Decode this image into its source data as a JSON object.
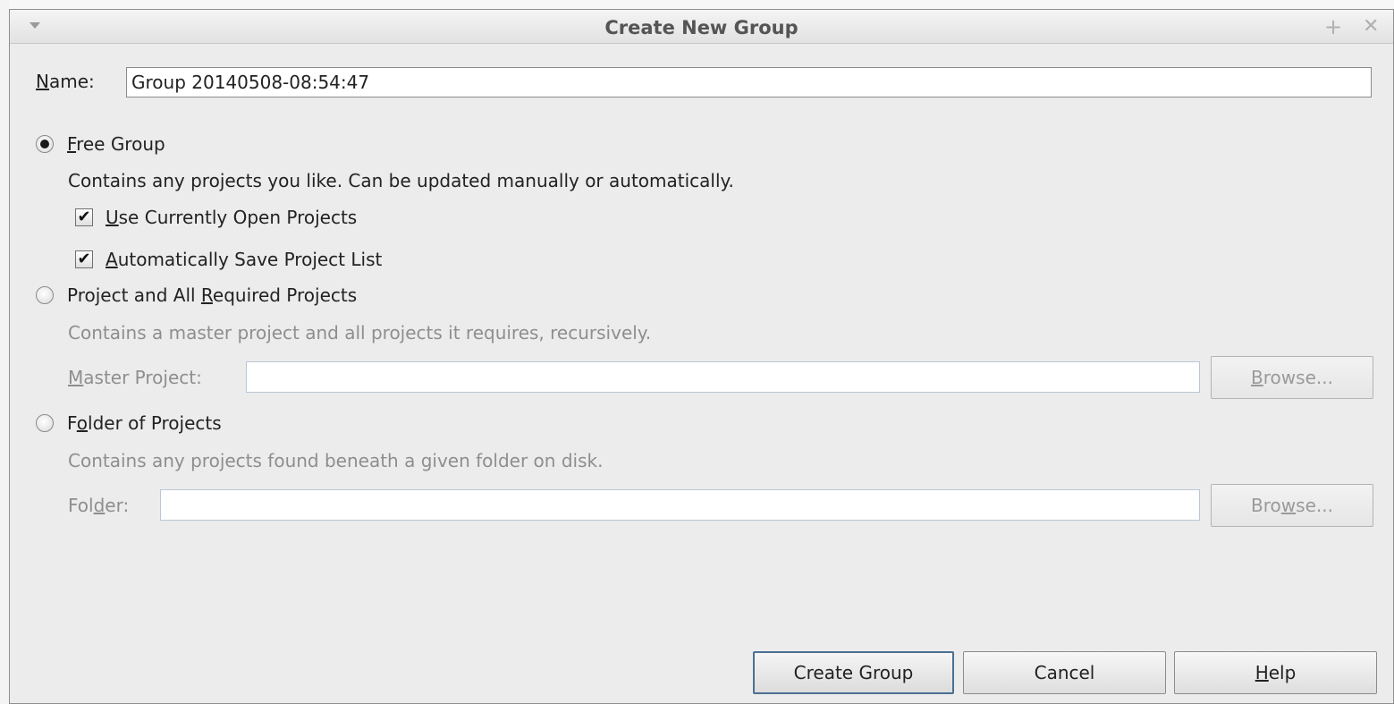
{
  "dialog": {
    "title": "Create New Group"
  },
  "name_field": {
    "label_mnemonic": "N",
    "label_rest": "ame:",
    "value": "Group 20140508-08:54:47"
  },
  "free_group": {
    "radio_mnemonic": "F",
    "radio_rest": "ree Group",
    "selected": true,
    "description": "Contains any projects you like. Can be updated manually or automatically.",
    "use_open_mnemonic": "U",
    "use_open_rest": "se Currently Open Projects",
    "use_open_checked": true,
    "auto_save_mnemonic": "A",
    "auto_save_rest": "utomatically Save Project List",
    "auto_save_checked": true
  },
  "project_group": {
    "radio_pre": "Project and All ",
    "radio_mnemonic": "R",
    "radio_rest": "equired Projects",
    "description": "Contains a master project and all projects it requires, recursively.",
    "master_mnemonic": "M",
    "master_rest": "aster Project:",
    "browse_mnemonic": "B",
    "browse_rest": "rowse..."
  },
  "folder_group": {
    "radio_pre": "F",
    "radio_mnemonic": "o",
    "radio_rest": "lder of Projects",
    "description": "Contains any projects found beneath a given folder on disk.",
    "folder_pre": "Fol",
    "folder_mnemonic": "d",
    "folder_rest": "er:",
    "browse_pre": "Bro",
    "browse_mnemonic": "w",
    "browse_rest": "se..."
  },
  "buttons": {
    "create": "Create Group",
    "cancel": "Cancel",
    "help_mnemonic": "H",
    "help_rest": "elp"
  }
}
